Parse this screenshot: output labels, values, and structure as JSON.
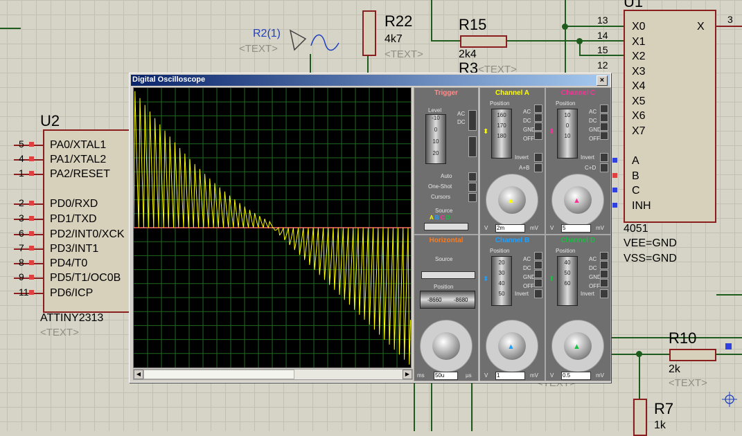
{
  "schematic": {
    "u2": {
      "ref": "U2",
      "part": "ATTINY2313",
      "text_placeholder": "<TEXT>",
      "pins": [
        {
          "num": "5",
          "label": "PA0/XTAL1"
        },
        {
          "num": "4",
          "label": "PA1/XTAL2"
        },
        {
          "num": "1",
          "label": "PA2/RESET"
        },
        {
          "num": "2",
          "label": "PD0/RXD"
        },
        {
          "num": "3",
          "label": "PD1/TXD"
        },
        {
          "num": "6",
          "label": "PD2/INT0/XCK"
        },
        {
          "num": "7",
          "label": "PD3/INT1"
        },
        {
          "num": "8",
          "label": "PD4/T0"
        },
        {
          "num": "9",
          "label": "PD5/T1/OC0B"
        },
        {
          "num": "11",
          "label": "PD6/ICP"
        }
      ]
    },
    "u1": {
      "ref": "U1",
      "part": "4051",
      "vee": "VEE=GND",
      "vss": "VSS=GND",
      "x_out": "X",
      "pin3": "3",
      "inputs": [
        {
          "num": "13",
          "label": "X0"
        },
        {
          "num": "14",
          "label": "X1"
        },
        {
          "num": "15",
          "label": "X2"
        },
        {
          "num": "12",
          "label": "X3"
        },
        {
          "num": "",
          "label": "X4"
        },
        {
          "num": "",
          "label": "X5"
        },
        {
          "num": "",
          "label": "X6"
        },
        {
          "num": "",
          "label": "X7"
        }
      ],
      "controls": [
        "A",
        "B",
        "C",
        "INH"
      ]
    },
    "r22": {
      "ref": "R22",
      "value": "4k7",
      "text": "<TEXT>"
    },
    "r15": {
      "ref": "R15",
      "value": "2k4"
    },
    "r2": {
      "ref": "R2(1)",
      "text": "<TEXT>"
    },
    "r3": {
      "ref": "R3",
      "text": "<TEXT>"
    },
    "r10": {
      "ref": "R10",
      "value": "2k",
      "text": "<TEXT>"
    },
    "r7": {
      "ref": "R7",
      "value": "1k"
    },
    "extra_text": "<TEXT>"
  },
  "scope": {
    "title": "Digital Oscilloscope",
    "close": "×",
    "trigger": {
      "title": "Trigger",
      "level_label": "Level",
      "scale": [
        "-10",
        "0",
        "10",
        "20"
      ],
      "modes": [
        "AC",
        "DC"
      ],
      "buttons": [
        "Auto",
        "One-Shot",
        "Cursors"
      ],
      "source_label": "Source",
      "sources": [
        "A",
        "B",
        "C",
        "D"
      ]
    },
    "channel_a": {
      "title": "Channel A",
      "position_label": "Position",
      "scale": [
        "160",
        "170",
        "180"
      ],
      "modes": [
        "AC",
        "DC",
        "GND",
        "OFF"
      ],
      "invert": "Invert",
      "combine": "A+B",
      "units": [
        "V",
        "mV"
      ],
      "value": "2m",
      "color": "#ffff00"
    },
    "channel_c": {
      "title": "Channel C",
      "position_label": "Position",
      "scale": [
        "10",
        "0",
        "10"
      ],
      "modes": [
        "AC",
        "DC",
        "GND",
        "OFF"
      ],
      "invert": "Invert",
      "combine": "C+D",
      "units": [
        "V",
        "mV"
      ],
      "value": "5",
      "color": "#ff2e9a"
    },
    "horizontal": {
      "title": "Horizontal",
      "source_label": "Source",
      "position_label": "Position",
      "pos_left": "-8660",
      "pos_right": "-8680",
      "value": "50u",
      "units": [
        "ms",
        "µs"
      ],
      "color": "#ff7a1a"
    },
    "channel_b": {
      "title": "Channel B",
      "position_label": "Position",
      "scale": [
        "20",
        "30",
        "40",
        "50"
      ],
      "modes": [
        "AC",
        "DC",
        "GND",
        "OFF"
      ],
      "invert": "Invert",
      "units": [
        "V",
        "mV"
      ],
      "value": "1",
      "color": "#1ea0ff"
    },
    "channel_d": {
      "title": "Channel D",
      "position_label": "Position",
      "scale": [
        "40",
        "50",
        "60"
      ],
      "modes": [
        "AC",
        "DC",
        "GND",
        "OFF"
      ],
      "invert": "Invert",
      "units": [
        "V",
        "mV"
      ],
      "value": "0.5",
      "color": "#16c040"
    }
  }
}
